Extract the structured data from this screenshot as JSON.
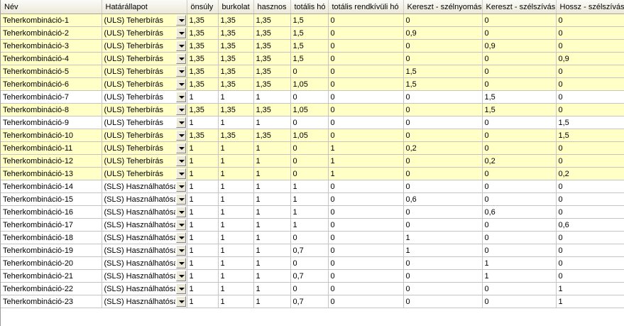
{
  "columns": [
    "Név",
    "Határállapot",
    "önsúly",
    "burkolat",
    "hasznos",
    "totális hó",
    "totális rendkívüli hó",
    "Kereszt - szélnyomás",
    "Kereszt - szélszívás",
    "Hossz - szélszívás"
  ],
  "colors": {
    "highlight": "#ffffc6",
    "normal": "#ffffff",
    "header": "#ece9d8"
  },
  "dropdown_icon": "chevron-down-icon",
  "rows": [
    {
      "name": "Teherkombináció-1",
      "state": "(ULS) Teherbírás",
      "values": [
        "1,35",
        "1,35",
        "1,35",
        "1,5",
        "0",
        "0",
        "0",
        "0"
      ],
      "highlight": true
    },
    {
      "name": "Teherkombináció-2",
      "state": "(ULS) Teherbírás",
      "values": [
        "1,35",
        "1,35",
        "1,35",
        "1,5",
        "0",
        "0,9",
        "0",
        "0"
      ],
      "highlight": true
    },
    {
      "name": "Teherkombináció-3",
      "state": "(ULS) Teherbírás",
      "values": [
        "1,35",
        "1,35",
        "1,35",
        "1,5",
        "0",
        "0",
        "0,9",
        "0"
      ],
      "highlight": true
    },
    {
      "name": "Teherkombináció-4",
      "state": "(ULS) Teherbírás",
      "values": [
        "1,35",
        "1,35",
        "1,35",
        "1,5",
        "0",
        "0",
        "0",
        "0,9"
      ],
      "highlight": true
    },
    {
      "name": "Teherkombináció-5",
      "state": "(ULS) Teherbírás",
      "values": [
        "1,35",
        "1,35",
        "1,35",
        "0",
        "0",
        "1,5",
        "0",
        "0"
      ],
      "highlight": true
    },
    {
      "name": "Teherkombináció-6",
      "state": "(ULS) Teherbírás",
      "values": [
        "1,35",
        "1,35",
        "1,35",
        "1,05",
        "0",
        "1,5",
        "0",
        "0"
      ],
      "highlight": true
    },
    {
      "name": "Teherkombináció-7",
      "state": "(ULS) Teherbírás",
      "values": [
        "1",
        "1",
        "1",
        "0",
        "0",
        "0",
        "1,5",
        "0"
      ],
      "highlight": false
    },
    {
      "name": "Teherkombináció-8",
      "state": "(ULS) Teherbírás",
      "values": [
        "1,35",
        "1,35",
        "1,35",
        "1,05",
        "0",
        "0",
        "1,5",
        "0"
      ],
      "highlight": true
    },
    {
      "name": "Teherkombináció-9",
      "state": "(ULS) Teherbírás",
      "values": [
        "1",
        "1",
        "1",
        "0",
        "0",
        "0",
        "0",
        "1,5"
      ],
      "highlight": false
    },
    {
      "name": "Teherkombináció-10",
      "state": "(ULS) Teherbírás",
      "values": [
        "1,35",
        "1,35",
        "1,35",
        "1,05",
        "0",
        "0",
        "0",
        "1,5"
      ],
      "highlight": true
    },
    {
      "name": "Teherkombináció-11",
      "state": "(ULS) Teherbírás",
      "values": [
        "1",
        "1",
        "1",
        "0",
        "1",
        "0,2",
        "0",
        "0"
      ],
      "highlight": true
    },
    {
      "name": "Teherkombináció-12",
      "state": "(ULS) Teherbírás",
      "values": [
        "1",
        "1",
        "1",
        "0",
        "1",
        "0",
        "0,2",
        "0"
      ],
      "highlight": true
    },
    {
      "name": "Teherkombináció-13",
      "state": "(ULS) Teherbírás",
      "values": [
        "1",
        "1",
        "1",
        "0",
        "1",
        "0",
        "0",
        "0,2"
      ],
      "highlight": true
    },
    {
      "name": "Teherkombináció-14",
      "state": "(SLS) Használhatósági",
      "values": [
        "1",
        "1",
        "1",
        "1",
        "0",
        "0",
        "0",
        "0"
      ],
      "highlight": false
    },
    {
      "name": "Teherkombináció-15",
      "state": "(SLS) Használhatósági",
      "values": [
        "1",
        "1",
        "1",
        "1",
        "0",
        "0,6",
        "0",
        "0"
      ],
      "highlight": false
    },
    {
      "name": "Teherkombináció-16",
      "state": "(SLS) Használhatósági",
      "values": [
        "1",
        "1",
        "1",
        "1",
        "0",
        "0",
        "0,6",
        "0"
      ],
      "highlight": false
    },
    {
      "name": "Teherkombináció-17",
      "state": "(SLS) Használhatósági",
      "values": [
        "1",
        "1",
        "1",
        "1",
        "0",
        "0",
        "0",
        "0,6"
      ],
      "highlight": false
    },
    {
      "name": "Teherkombináció-18",
      "state": "(SLS) Használhatósági",
      "values": [
        "1",
        "1",
        "1",
        "0",
        "0",
        "1",
        "0",
        "0"
      ],
      "highlight": false
    },
    {
      "name": "Teherkombináció-19",
      "state": "(SLS) Használhatósági",
      "values": [
        "1",
        "1",
        "1",
        "0,7",
        "0",
        "1",
        "0",
        "0"
      ],
      "highlight": false
    },
    {
      "name": "Teherkombináció-20",
      "state": "(SLS) Használhatósági",
      "values": [
        "1",
        "1",
        "1",
        "0",
        "0",
        "0",
        "1",
        "0"
      ],
      "highlight": false
    },
    {
      "name": "Teherkombináció-21",
      "state": "(SLS) Használhatósági",
      "values": [
        "1",
        "1",
        "1",
        "0,7",
        "0",
        "0",
        "1",
        "0"
      ],
      "highlight": false
    },
    {
      "name": "Teherkombináció-22",
      "state": "(SLS) Használhatósági",
      "values": [
        "1",
        "1",
        "1",
        "0",
        "0",
        "0",
        "0",
        "1"
      ],
      "highlight": false
    },
    {
      "name": "Teherkombináció-23",
      "state": "(SLS) Használhatósági",
      "values": [
        "1",
        "1",
        "1",
        "0,7",
        "0",
        "0",
        "0",
        "1"
      ],
      "highlight": false
    }
  ]
}
